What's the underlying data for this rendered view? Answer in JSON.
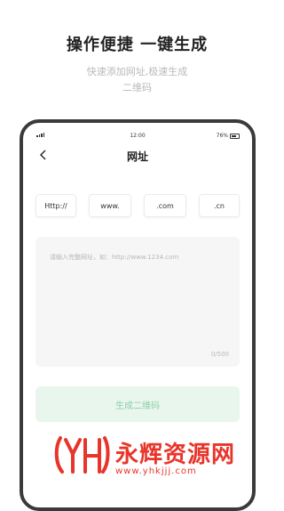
{
  "promo": {
    "title": "操作便捷 一键生成",
    "subtitle_line1": "快速添加网址,极速生成",
    "subtitle_line2": "二维码"
  },
  "status_bar": {
    "time": "12:00",
    "battery": "76%"
  },
  "nav": {
    "title": "网址",
    "back_icon": "chevron-left-icon"
  },
  "chips": [
    {
      "label": "Http://"
    },
    {
      "label": "www."
    },
    {
      "label": ".com"
    },
    {
      "label": ".cn"
    }
  ],
  "url_input": {
    "placeholder": "请输入完整网址，如：http://www.1234.com",
    "counter": "0/500"
  },
  "generate_button": {
    "label": "生成二维码"
  },
  "watermark": {
    "text": "永辉资源网",
    "url": "www.yhkjjj.com"
  },
  "colors": {
    "button_bg": "#e8f6ee",
    "button_text": "#8fcfa8",
    "watermark": "#e8352b"
  }
}
